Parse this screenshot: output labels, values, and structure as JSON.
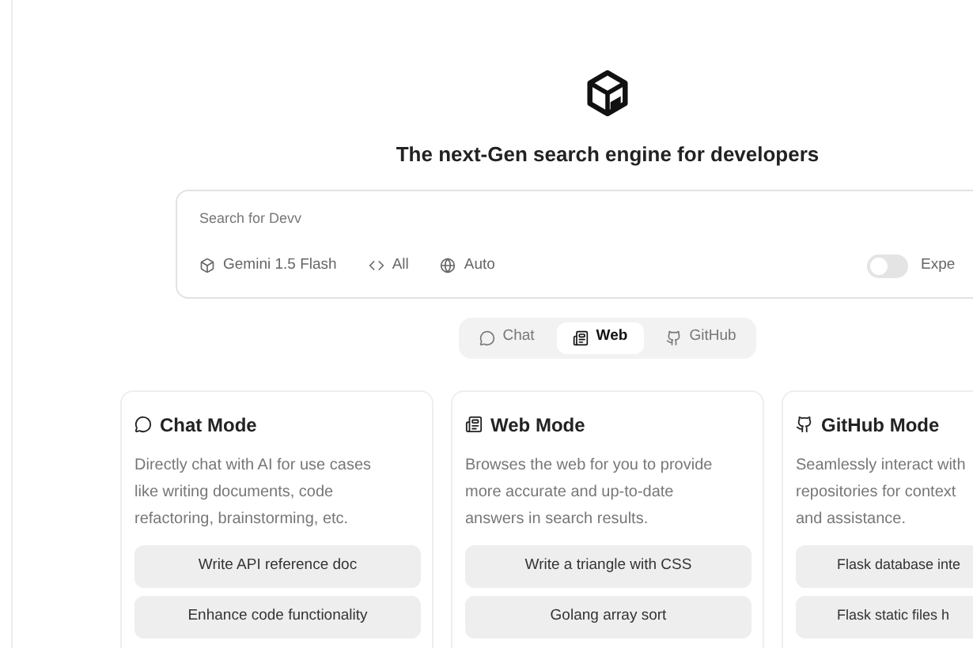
{
  "headline": "The next-Gen search engine for developers",
  "search": {
    "placeholder": "Search for Devv",
    "options": [
      {
        "kind": "model",
        "label": "Gemini 1.5 Flash"
      },
      {
        "kind": "code",
        "label": "All"
      },
      {
        "kind": "globe",
        "label": "Auto"
      }
    ],
    "toggle": {
      "on": false,
      "label": "Expe"
    }
  },
  "tabs": [
    {
      "kind": "chat",
      "label": "Chat",
      "selected": false
    },
    {
      "kind": "web",
      "label": "Web",
      "selected": true
    },
    {
      "kind": "github",
      "label": "GitHub",
      "selected": false
    }
  ],
  "cards": [
    {
      "kind": "chat",
      "title": "Chat Mode",
      "description_lines": [
        "Directly chat with AI for use cases",
        "like writing documents, code",
        "refactoring, brainstorming, etc."
      ],
      "examples": [
        "Write API reference doc",
        "Enhance code functionality"
      ]
    },
    {
      "kind": "web",
      "title": "Web Mode",
      "description_lines": [
        "Browses the web for you to provide",
        "more accurate and up-to-date",
        "answers in search results."
      ],
      "examples": [
        "Write a triangle with CSS",
        "Golang array sort"
      ]
    },
    {
      "kind": "github",
      "title": "GitHub Mode",
      "description_lines": [
        "Seamlessly interact with",
        "repositories for context",
        "and assistance."
      ],
      "examples": [
        "Flask database inte",
        "Flask static files h"
      ]
    }
  ]
}
